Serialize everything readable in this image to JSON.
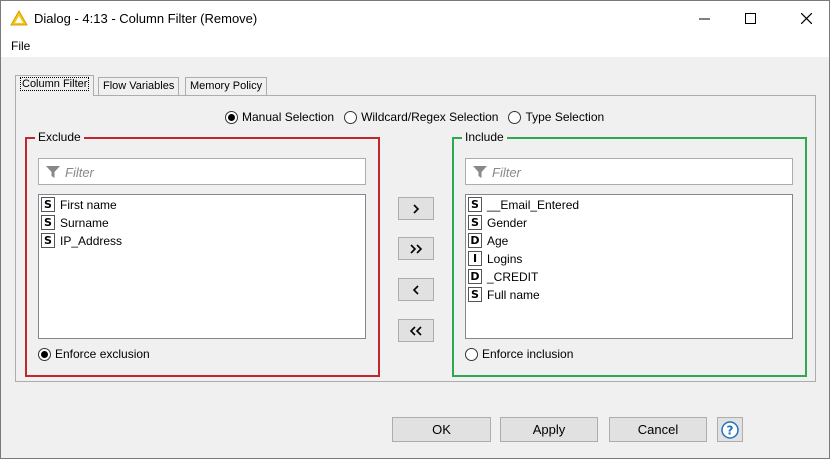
{
  "window": {
    "title": "Dialog - 4:13 - Column Filter (Remove)"
  },
  "menu": {
    "file": "File"
  },
  "tabs": [
    {
      "label": "Column Filter",
      "active": true
    },
    {
      "label": "Flow Variables",
      "active": false
    },
    {
      "label": "Memory Policy",
      "active": false
    }
  ],
  "selection_mode": {
    "options": [
      {
        "label": "Manual Selection",
        "checked": true
      },
      {
        "label": "Wildcard/Regex Selection",
        "checked": false
      },
      {
        "label": "Type Selection",
        "checked": false
      }
    ]
  },
  "exclude": {
    "label": "Exclude",
    "filter_placeholder": "Filter",
    "items": [
      {
        "type": "S",
        "name": "First name"
      },
      {
        "type": "S",
        "name": "Surname"
      },
      {
        "type": "S",
        "name": "IP_Address"
      }
    ],
    "enforce_label": "Enforce exclusion",
    "enforce_checked": true
  },
  "include": {
    "label": "Include",
    "filter_placeholder": "Filter",
    "items": [
      {
        "type": "S",
        "name": "__Email_Entered"
      },
      {
        "type": "S",
        "name": "Gender"
      },
      {
        "type": "D",
        "name": "Age"
      },
      {
        "type": "I",
        "name": "Logins"
      },
      {
        "type": "D",
        "name": "_CREDIT"
      },
      {
        "type": "S",
        "name": "Full name"
      }
    ],
    "enforce_label": "Enforce inclusion",
    "enforce_checked": false
  },
  "move_buttons": {
    "add": "›",
    "add_all": "»",
    "remove": "‹",
    "remove_all": "«"
  },
  "buttons": {
    "ok": "OK",
    "apply": "Apply",
    "cancel": "Cancel",
    "help": "?"
  },
  "colors": {
    "exclude_border": "#c0282d",
    "include_border": "#2fa84f",
    "app_icon": "#f5c518",
    "help_icon": "#1e73be"
  }
}
